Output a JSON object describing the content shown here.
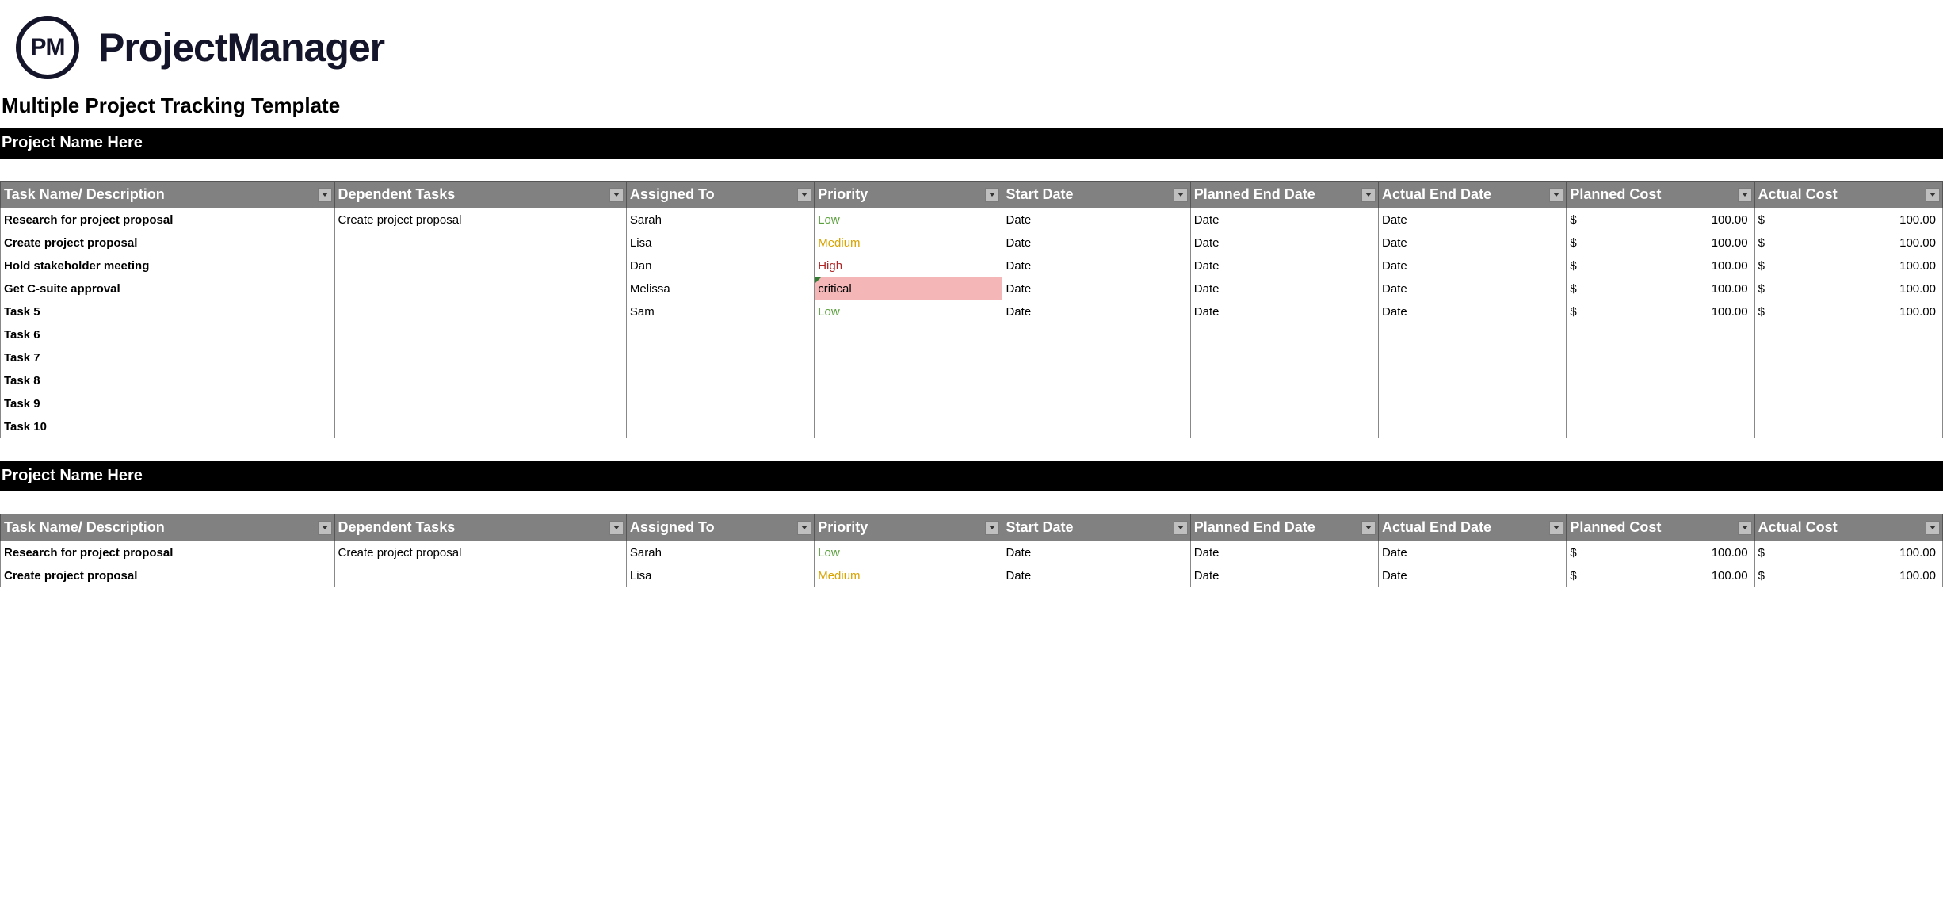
{
  "brand": {
    "logo_text": "PM",
    "name": "ProjectManager"
  },
  "page_title": "Multiple Project Tracking Template",
  "columns": [
    "Task Name/ Description",
    "Dependent Tasks",
    "Assigned To",
    "Priority",
    "Start Date",
    "Planned End Date",
    "Actual End Date",
    "Planned Cost",
    "Actual Cost"
  ],
  "money": {
    "currency": "$"
  },
  "projects": [
    {
      "name": "Project Name Here",
      "rows": [
        {
          "task": "Research for project proposal",
          "dependent": "Create project proposal",
          "assigned": "Sarah",
          "priority": "Low",
          "start": "Date",
          "planned_end": "Date",
          "actual_end": "Date",
          "planned_cost": "100.00",
          "actual_cost": "100.00"
        },
        {
          "task": "Create project proposal",
          "dependent": "",
          "assigned": "Lisa",
          "priority": "Medium",
          "start": "Date",
          "planned_end": "Date",
          "actual_end": "Date",
          "planned_cost": "100.00",
          "actual_cost": "100.00"
        },
        {
          "task": "Hold stakeholder meeting",
          "dependent": "",
          "assigned": "Dan",
          "priority": "High",
          "start": "Date",
          "planned_end": "Date",
          "actual_end": "Date",
          "planned_cost": "100.00",
          "actual_cost": "100.00"
        },
        {
          "task": "Get C-suite approval",
          "dependent": "",
          "assigned": "Melissa",
          "priority": "critical",
          "start": "Date",
          "planned_end": "Date",
          "actual_end": "Date",
          "planned_cost": "100.00",
          "actual_cost": "100.00"
        },
        {
          "task": "Task 5",
          "dependent": "",
          "assigned": "Sam",
          "priority": "Low",
          "start": "Date",
          "planned_end": "Date",
          "actual_end": "Date",
          "planned_cost": "100.00",
          "actual_cost": "100.00"
        },
        {
          "task": "Task 6",
          "dependent": "",
          "assigned": "",
          "priority": "",
          "start": "",
          "planned_end": "",
          "actual_end": "",
          "planned_cost": "",
          "actual_cost": ""
        },
        {
          "task": "Task 7",
          "dependent": "",
          "assigned": "",
          "priority": "",
          "start": "",
          "planned_end": "",
          "actual_end": "",
          "planned_cost": "",
          "actual_cost": ""
        },
        {
          "task": "Task 8",
          "dependent": "",
          "assigned": "",
          "priority": "",
          "start": "",
          "planned_end": "",
          "actual_end": "",
          "planned_cost": "",
          "actual_cost": ""
        },
        {
          "task": "Task 9",
          "dependent": "",
          "assigned": "",
          "priority": "",
          "start": "",
          "planned_end": "",
          "actual_end": "",
          "planned_cost": "",
          "actual_cost": ""
        },
        {
          "task": "Task 10",
          "dependent": "",
          "assigned": "",
          "priority": "",
          "start": "",
          "planned_end": "",
          "actual_end": "",
          "planned_cost": "",
          "actual_cost": ""
        }
      ]
    },
    {
      "name": "Project Name Here",
      "rows": [
        {
          "task": "Research for project proposal",
          "dependent": "Create project proposal",
          "assigned": "Sarah",
          "priority": "Low",
          "start": "Date",
          "planned_end": "Date",
          "actual_end": "Date",
          "planned_cost": "100.00",
          "actual_cost": "100.00"
        },
        {
          "task": "Create project proposal",
          "dependent": "",
          "assigned": "Lisa",
          "priority": "Medium",
          "start": "Date",
          "planned_end": "Date",
          "actual_end": "Date",
          "planned_cost": "100.00",
          "actual_cost": "100.00"
        }
      ]
    }
  ]
}
